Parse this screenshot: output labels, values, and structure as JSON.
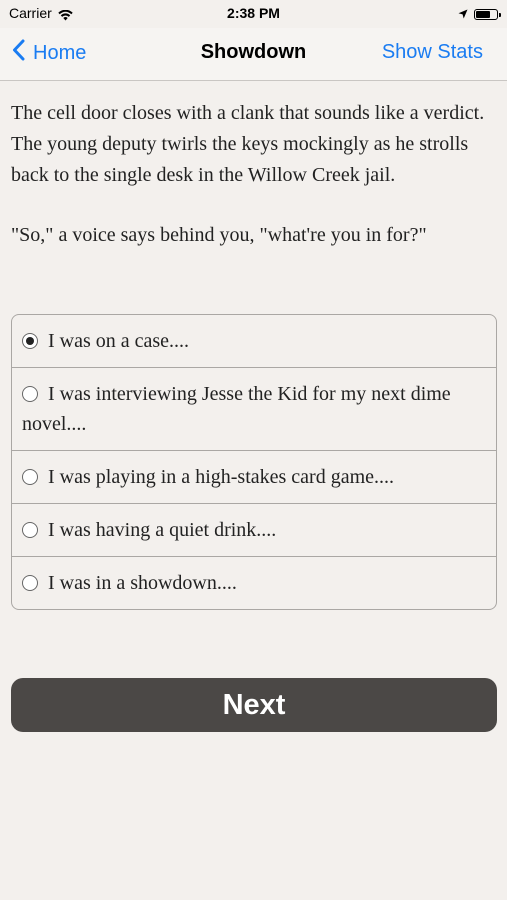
{
  "status_bar": {
    "carrier": "Carrier",
    "time": "2:38 PM",
    "battery_level": 0.62
  },
  "nav": {
    "back_label": "Home",
    "title": "Showdown",
    "right_label": "Show Stats"
  },
  "story": {
    "paragraphs": [
      "The cell door closes with a clank that sounds like a verdict. The young deputy twirls the keys mockingly as he strolls back to the single desk in the Willow Creek jail.",
      "\"So,\" a voice says behind you, \"what're you in for?\""
    ]
  },
  "choices": [
    {
      "label": "I was on a case....",
      "selected": true
    },
    {
      "label": "I was interviewing Jesse the Kid for my next dime novel....",
      "selected": false
    },
    {
      "label": "I was playing in a high-stakes card game....",
      "selected": false
    },
    {
      "label": "I was having a quiet drink....",
      "selected": false
    },
    {
      "label": "I was in a showdown....",
      "selected": false
    }
  ],
  "next_button": {
    "label": "Next"
  },
  "colors": {
    "accent": "#1a7cf2",
    "background": "#f3f0ed",
    "button": "#4b4846"
  },
  "icons": {
    "back": "chevron-left-icon",
    "wifi": "wifi-icon",
    "location": "location-arrow-icon",
    "battery": "battery-icon"
  }
}
